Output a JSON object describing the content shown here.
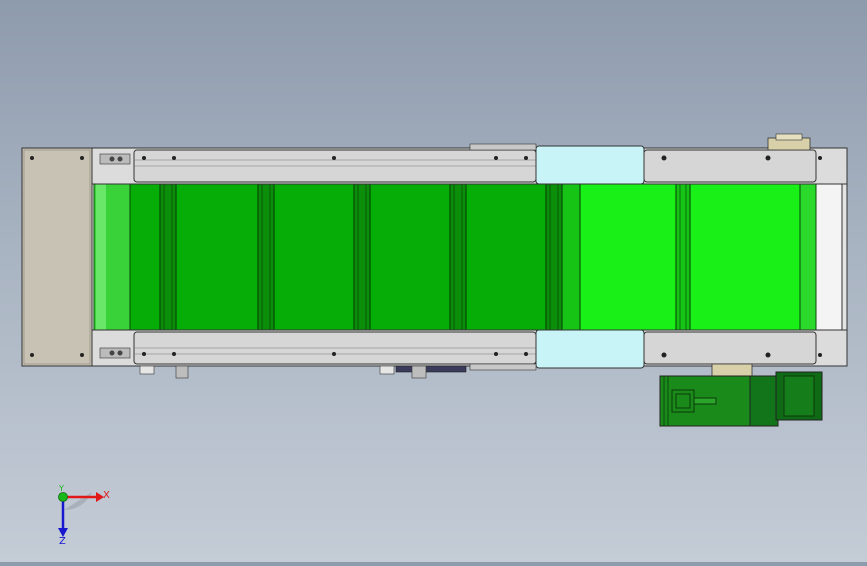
{
  "view": {
    "triad": {
      "x_label": "X",
      "y_label": "Y",
      "z_label": "Z"
    }
  },
  "colors": {
    "background_top": "#8e9bad",
    "background_bottom": "#c4ccd6",
    "belt_dark": "#07ad07",
    "belt_bright": "#18f018",
    "cleat": "#0a7a0a",
    "rail": "#d9d9d9",
    "end_plate": "#c8c2b4",
    "guard_cyan": "#c9f4f7",
    "motor": "#1a8a1a",
    "axis_x": "#e01818",
    "axis_y": "#18b818",
    "axis_z": "#1818d0"
  }
}
